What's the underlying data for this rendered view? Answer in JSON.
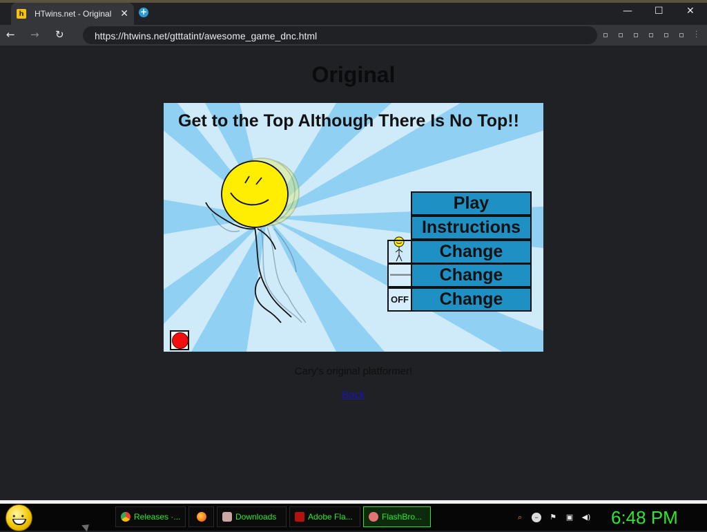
{
  "browser": {
    "tab_title": "HTwins.net - Original",
    "favicon_glyph": "h",
    "url": "https://htwins.net/gtttatint/awesome_game_dnc.html",
    "window_controls": {
      "minimize": "—",
      "maximize": "☐",
      "close": "✕"
    },
    "nav": {
      "back": "←",
      "forward": "→",
      "reload": "↻"
    },
    "tab_close": "✕",
    "new_tab": "+"
  },
  "page": {
    "heading": "Original",
    "caption": "Cary's original platformer!",
    "back_link": "Back"
  },
  "game": {
    "title": "Get to the Top Although There Is No Top!!",
    "menu": {
      "play": "Play",
      "instructions": "Instructions",
      "change_character": "Change",
      "change_volume": "Change",
      "change_sound": "Change"
    },
    "sound_state": "OFF",
    "colors": {
      "sky": "#cfeaf9",
      "ray": "#8fd0f3",
      "button": "#1e90c4",
      "smiley": "#ffee00",
      "stop": "#f01010"
    }
  },
  "taskbar": {
    "items": [
      {
        "label": "Releases ·...",
        "icon": "chrome-icon",
        "color": "#e94235"
      },
      {
        "label": "",
        "icon": "firefox-icon",
        "color": "#ff7a18"
      },
      {
        "label": "Downloads",
        "icon": "folder-icon",
        "color": "#caa6a6"
      },
      {
        "label": "Adobe Fla...",
        "icon": "flash-icon",
        "color": "#b3120f"
      },
      {
        "label": "FlashBro...",
        "icon": "flashbrowser-icon",
        "color": "#e37474"
      }
    ],
    "clock": "6:48 PM",
    "tray": [
      "search-icon",
      "messenger-icon",
      "flag-icon",
      "network-icon",
      "volume-icon"
    ]
  }
}
